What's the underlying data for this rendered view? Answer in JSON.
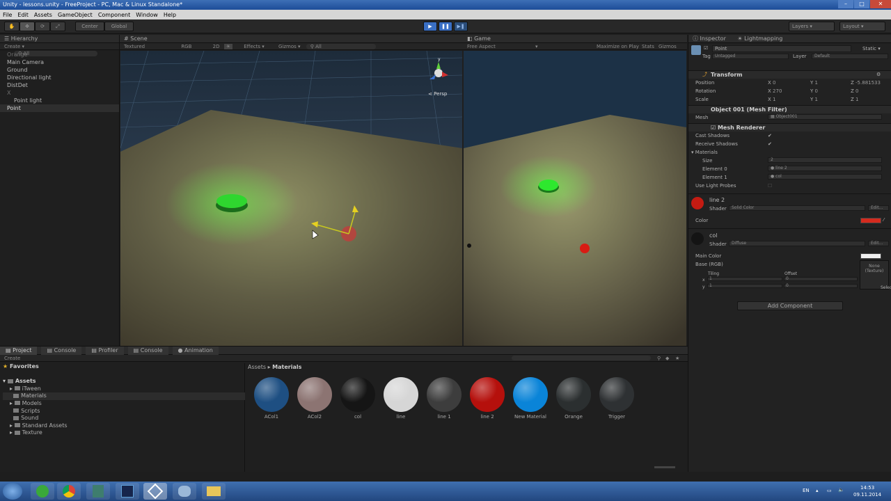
{
  "window": {
    "title": "Unity - lessons.unity - FreeProject - PC, Mac & Linux Standalone*",
    "minimize": "–",
    "maximize": "□",
    "close": "✕"
  },
  "menu": [
    "File",
    "Edit",
    "Assets",
    "GameObject",
    "Component",
    "Window",
    "Help"
  ],
  "toolbar": {
    "center": "Center",
    "global": "Global",
    "layers": "Layers",
    "layout": "Layout"
  },
  "hierarchy": {
    "tab": "Hierarchy",
    "create": "Create",
    "search_placeholder": "All",
    "items": [
      {
        "label": "Orange",
        "state": "dim"
      },
      {
        "label": "Main Camera",
        "state": "normal"
      },
      {
        "label": "Ground",
        "state": "normal"
      },
      {
        "label": "Directional light",
        "state": "normal"
      },
      {
        "label": "DistDet",
        "state": "normal"
      },
      {
        "label": "X",
        "state": "dim"
      },
      {
        "label": "Point light",
        "state": "child"
      },
      {
        "label": "Point",
        "state": "selected"
      }
    ]
  },
  "scene": {
    "tab": "Scene",
    "toolbar": [
      "Textured",
      "RGB",
      "2D",
      "Effects",
      "Gizmos"
    ],
    "search_placeholder": "All",
    "persp": "Persp"
  },
  "game": {
    "tab": "Game",
    "aspect": "Free Aspect",
    "controls": [
      "Maximize on Play",
      "Stats",
      "Gizmos"
    ]
  },
  "inspector": {
    "tabs": [
      "Inspector",
      "Lightmapping"
    ],
    "object_name": "Point",
    "static": "Static",
    "tag_label": "Tag",
    "tag_value": "Untagged",
    "layer_label": "Layer",
    "layer_value": "Default",
    "transform": {
      "title": "Transform",
      "position": {
        "label": "Position",
        "x": "0",
        "y": "1",
        "z": "-5.881533"
      },
      "rotation": {
        "label": "Rotation",
        "x": "270",
        "y": "0",
        "z": "0"
      },
      "scale": {
        "label": "Scale",
        "x": "1",
        "y": "1",
        "z": "1"
      }
    },
    "mesh_filter": {
      "title": "Object 001 (Mesh Filter)",
      "mesh_label": "Mesh",
      "mesh_value": "Object001"
    },
    "mesh_renderer": {
      "title": "Mesh Renderer",
      "cast_shadows": "Cast Shadows",
      "receive_shadows": "Receive Shadows",
      "materials": "Materials",
      "size_label": "Size",
      "size_value": "2",
      "element0_label": "Element 0",
      "element0_value": "line 2",
      "element1_label": "Element 1",
      "element1_value": "col",
      "use_light_probes": "Use Light Probes"
    },
    "material1": {
      "name": "line 2",
      "shader_label": "Shader",
      "shader_value": "Solid Color",
      "edit": "Edit...",
      "color_label": "Color",
      "color": "#d42a1e"
    },
    "material2": {
      "name": "col",
      "shader_label": "Shader",
      "shader_value": "Diffuse",
      "edit": "Edit...",
      "main_color": "Main Color",
      "base_rgb": "Base (RGB)",
      "tiling": "Tiling",
      "offset": "Offset",
      "x": "x",
      "y": "y",
      "tiling_x": "1",
      "tiling_y": "1",
      "offset_x": "0",
      "offset_y": "0",
      "texture_none": "None (Texture)",
      "select": "Select"
    },
    "add_component": "Add Component"
  },
  "bottom_tabs": [
    "Project",
    "Console",
    "Profiler",
    "Console",
    "Animation"
  ],
  "project": {
    "create": "Create",
    "favorites": "Favorites",
    "assets": "Assets",
    "folders": [
      "iTween",
      "Materials",
      "Models",
      "Scripts",
      "Sound",
      "Standard Assets",
      "Texture"
    ],
    "selected_folder": "Materials",
    "breadcrumb_root": "Assets",
    "breadcrumb_sep": "▸",
    "breadcrumb_current": "Materials",
    "materials": [
      {
        "name": "ACol1",
        "color": "#1e4f82"
      },
      {
        "name": "ACol2",
        "color": "#8c7472"
      },
      {
        "name": "col",
        "color": "#151515"
      },
      {
        "name": "line",
        "color": "#d6d6d6"
      },
      {
        "name": "line 1",
        "color": "#3d3d3d"
      },
      {
        "name": "line 2",
        "color": "#b5100c"
      },
      {
        "name": "New Material",
        "color": "#0a84d8"
      },
      {
        "name": "Orange",
        "color": "#2b2f30"
      },
      {
        "name": "Trigger",
        "color": "#2e3133"
      }
    ]
  },
  "taskbar": {
    "lang": "EN",
    "time": "14:53",
    "date": "09.11.2014"
  }
}
